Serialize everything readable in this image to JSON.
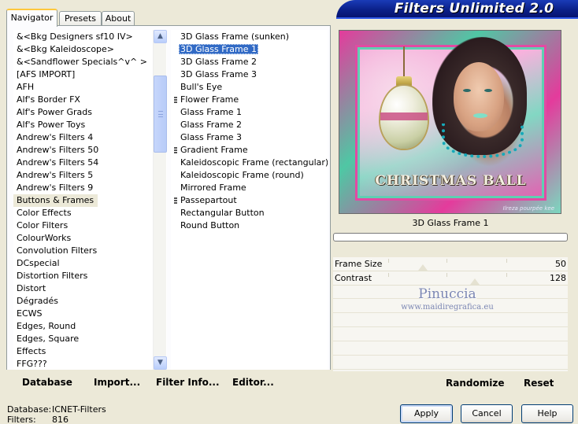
{
  "tabs": [
    {
      "label": "Navigator",
      "active": true
    },
    {
      "label": "Presets",
      "active": false
    },
    {
      "label": "About",
      "active": false
    }
  ],
  "banner": {
    "title": "Filters Unlimited 2.0"
  },
  "categories": {
    "items": [
      "&<Bkg Designers sf10 IV>",
      "&<Bkg Kaleidoscope>",
      "&<Sandflower Specials^v^ >",
      "[AFS IMPORT]",
      "AFH",
      "Alf's Border FX",
      "Alf's Power Grads",
      "Alf's Power Toys",
      "Andrew's Filters 4",
      "Andrew's Filters 50",
      "Andrew's Filters 54",
      "Andrew's Filters 5",
      "Andrew's Filters 9",
      "Buttons & Frames",
      "Color Effects",
      "Color Filters",
      "ColourWorks",
      "Convolution Filters",
      "DCspecial",
      "Distortion Filters",
      "Distort",
      "Dégradés",
      "ECWS",
      "Edges, Round",
      "Edges, Square",
      "Effects",
      "FFG???"
    ],
    "selected": "Buttons & Frames",
    "scroll_up_icon": "arrow-up-icon",
    "scroll_down_icon": "arrow-down-icon"
  },
  "filters": {
    "items": [
      {
        "label": "3D Glass Frame (sunken)",
        "group": false
      },
      {
        "label": "3D Glass Frame 1",
        "group": false
      },
      {
        "label": "3D Glass Frame 2",
        "group": false
      },
      {
        "label": "3D Glass Frame 3",
        "group": false
      },
      {
        "label": "Bull's Eye",
        "group": false
      },
      {
        "label": "Flower Frame",
        "group": true
      },
      {
        "label": "Glass Frame 1",
        "group": false
      },
      {
        "label": "Glass Frame 2",
        "group": false
      },
      {
        "label": "Glass Frame 3",
        "group": false
      },
      {
        "label": "Gradient Frame",
        "group": true
      },
      {
        "label": "Kaleidoscopic Frame (rectangular)",
        "group": false
      },
      {
        "label": "Kaleidoscopic Frame (round)",
        "group": false
      },
      {
        "label": "Mirrored Frame",
        "group": false
      },
      {
        "label": "Passepartout",
        "group": true
      },
      {
        "label": "Rectangular Button",
        "group": false
      },
      {
        "label": "Round Button",
        "group": false
      }
    ],
    "selected": "3D Glass Frame 1"
  },
  "list_actions": {
    "database": "Database",
    "import": "Import...",
    "filter_info": "Filter Info...",
    "editor": "Editor..."
  },
  "preview": {
    "caption": "CHRISTMAS BALL",
    "small_text": "Ilreza pourpée kee",
    "filter_name": "3D Glass Frame 1",
    "progress": 0
  },
  "params": [
    {
      "label": "Frame Size",
      "value": "50",
      "fraction": 0.2
    },
    {
      "label": "Contrast",
      "value": "128",
      "fraction": 0.5
    }
  ],
  "watermark": {
    "name": "Pinuccia",
    "url": "www.maidiregrafica.eu"
  },
  "param_actions": {
    "randomize": "Randomize",
    "reset": "Reset"
  },
  "status": {
    "database_label": "Database:",
    "database_value": "ICNET-Filters",
    "filters_label": "Filters:",
    "filters_value": "816"
  },
  "buttons": {
    "apply": "Apply",
    "cancel": "Cancel",
    "help": "Help"
  }
}
